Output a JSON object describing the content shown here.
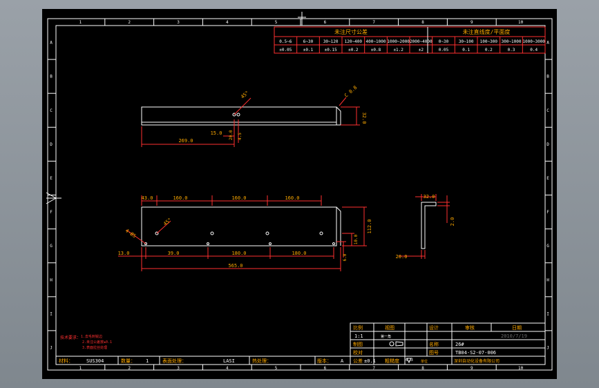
{
  "border": {
    "cols": [
      "1",
      "2",
      "3",
      "4",
      "5",
      "6",
      "7",
      "8",
      "9",
      "10"
    ],
    "rows": [
      "A",
      "B",
      "C",
      "D",
      "E",
      "F",
      "G",
      "H",
      "I",
      "J"
    ]
  },
  "tol_table": {
    "linear_title": "未注尺寸公差",
    "angular_title": "未注直线度/平面度",
    "ranges": [
      "0.5~6",
      "6~30",
      "30~120",
      "120~400",
      "400~1000",
      "1000~2000",
      "2000~4000",
      "0~30",
      "30~100",
      "100~300",
      "300~1000",
      "1000~3000"
    ],
    "values": [
      "±0.05",
      "±0.1",
      "±0.15",
      "±0.2",
      "±0.8",
      "±1.2",
      "±2",
      "0.05",
      "0.1",
      "0.2",
      "0.3",
      "0.4"
    ]
  },
  "views": {
    "top": {
      "dims": {
        "overall_len": "269.0",
        "hole_offset": "15.0",
        "height": "32.0",
        "chamfer": "C 0.8",
        "angle": "45°",
        "v1": "20.0",
        "v2": "4.5"
      }
    },
    "front": {
      "dims": {
        "s1": "43.0",
        "s2": "160.0",
        "s3": "160.0",
        "s4": "160.0",
        "b1": "13.0",
        "b2": "39.0",
        "b3": "180.0",
        "b4": "180.0",
        "overall": "565.0",
        "h1": "112.0",
        "h2": "10.0",
        "h3": "6.0",
        "angle": "45°",
        "dia": "4-Ø5"
      }
    },
    "side": {
      "dims": {
        "top": "32.0",
        "side": "2.0",
        "bottom": "20.0"
      }
    }
  },
  "notes": {
    "title": "技术要求：",
    "line1": "1.去毛刺锐边",
    "line2": "2.未注公差按±0.1",
    "line3": "3.表面拉丝处理"
  },
  "title_block": {
    "h_scale": "比例",
    "h_view": "视图",
    "h_design": "设计",
    "h_review": "审核",
    "h_date": "日期",
    "scale": "1:1",
    "view_note": "第一角",
    "date": "2010/7/19",
    "r_drawn": "制图",
    "r_check": "校对",
    "name_label": "名称",
    "name": "26#",
    "r_process": "工艺",
    "r_approve": "批准",
    "num_label": "图号",
    "num": "TB04-S2-07-006",
    "tol_label": "公差",
    "tol": "±0.1",
    "unit_label": "单位",
    "rough_label": "粗糙度",
    "rough": "6.3",
    "company": "深圳自动化设备有限公司",
    "material_label": "材料：",
    "material": "SUS304",
    "qty_label": "数量：",
    "qty": "1",
    "surface_label": "表面处理：",
    "surface": "LASI",
    "heat_label": "热处理：",
    "rev_label": "版本：",
    "rev": "A"
  }
}
